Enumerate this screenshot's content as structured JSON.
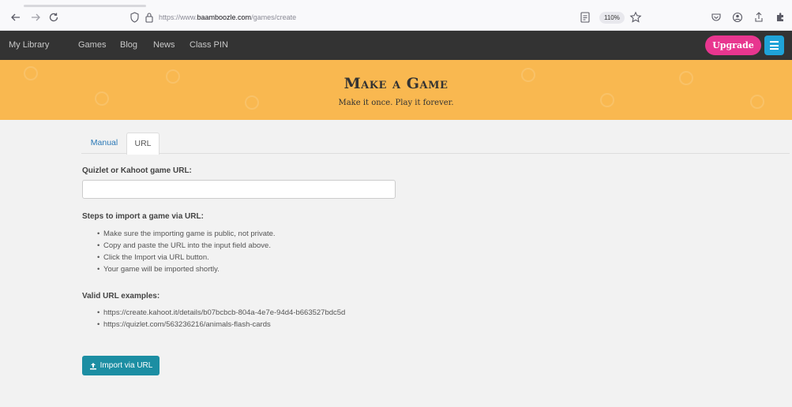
{
  "browser": {
    "url_prefix": "https://www.",
    "url_domain": "baamboozle.com",
    "url_path": "/games/create",
    "zoom": "110%"
  },
  "nav": {
    "items": [
      "My Library",
      "Games",
      "Blog",
      "News",
      "Class PIN"
    ],
    "upgrade_label": "Upgrade"
  },
  "banner": {
    "title": "Make a Game",
    "subtitle": "Make it once. Play it forever."
  },
  "tabs": [
    {
      "label": "Manual",
      "active": false
    },
    {
      "label": "URL",
      "active": true
    }
  ],
  "form": {
    "url_label": "Quizlet or Kahoot game URL:",
    "url_value": "",
    "steps_heading": "Steps to import a game via URL:",
    "steps": [
      "Make sure the importing game is public, not private.",
      "Copy and paste the URL into the input field above.",
      "Click the Import via URL button.",
      "Your game will be imported shortly."
    ],
    "examples_heading": "Valid URL examples:",
    "examples": [
      "https://create.kahoot.it/details/b07bcbcb-804a-4e7e-94d4-b663527bdc5d",
      "https://quizlet.com/563236216/animals-flash-cards"
    ],
    "import_label": "Import via URL"
  },
  "colors": {
    "banner": "#f9b850",
    "nav": "#333333",
    "upgrade": "#e8368f",
    "menu": "#1fa3d8",
    "import": "#1c8ea3",
    "link": "#2a78b6"
  },
  "icons": [
    "back-arrow-icon",
    "forward-arrow-icon",
    "reload-icon",
    "shield-icon",
    "lock-icon",
    "reader-view-icon",
    "star-icon",
    "pocket-icon",
    "account-icon",
    "share-icon",
    "extension-icon",
    "menu-icon",
    "upload-icon"
  ]
}
